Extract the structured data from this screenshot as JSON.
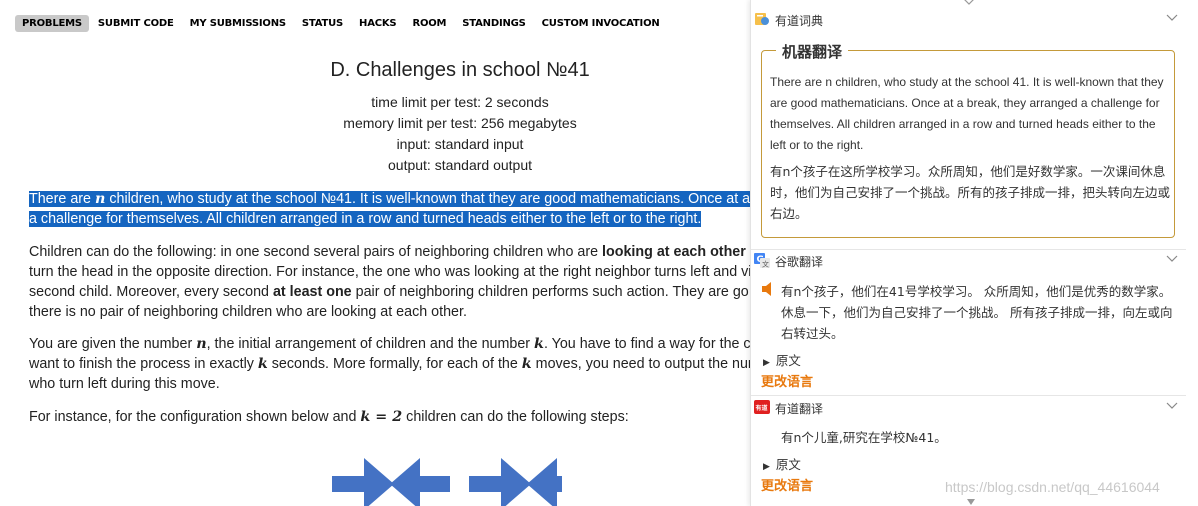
{
  "nav": {
    "items": [
      "PROBLEMS",
      "SUBMIT CODE",
      "MY SUBMISSIONS",
      "STATUS",
      "HACKS",
      "ROOM",
      "STANDINGS",
      "CUSTOM INVOCATION"
    ],
    "active": "PROBLEMS"
  },
  "problem": {
    "title": "D. Challenges in school №41",
    "time_limit": "time limit per test: 2 seconds",
    "memory_limit": "memory limit per test: 256 megabytes",
    "input": "input: standard input",
    "output": "output: standard output",
    "p1": {
      "line1_a": "There are ",
      "line1_var": "n",
      "line1_b": " children, who study at the school №41. It is well-known that they are good mathematicians. Once at a b",
      "line2": "a challenge for themselves. All children arranged in a row and turned heads either to the left or to the right."
    },
    "p2": {
      "line1_a": "Children can do the following: in one second several pairs of neighboring children who are ",
      "line1_bold": "looking at each other",
      "line2": "turn the head in the opposite direction. For instance, the one who was looking at the right neighbor turns left and vi",
      "line3_a": "second child. Moreover, every second ",
      "line3_bold": "at least one",
      "line3_b": " pair of neighboring children performs such action. They are go",
      "line4": "there is no pair of neighboring children who are looking at each other."
    },
    "p3": {
      "line1_a": "You are given the number ",
      "line1_var1": "n",
      "line1_b": ", the initial arrangement of children and the number ",
      "line1_var2": "k",
      "line1_c": ". You have to find a way for the ch",
      "line2_a": "want to finish the process in exactly ",
      "line2_var": "k",
      "line2_b": " seconds. More formally, for each of the ",
      "line2_var2": "k",
      "line2_c": " moves, you need to output the num",
      "line3": "who turn left during this move."
    },
    "p4": {
      "a": "For instance, for the configuration shown below and ",
      "var": "k = 2",
      "b": " children can do the following steps:"
    }
  },
  "panel": {
    "youdao_dict": {
      "label": "有道词典",
      "mt_title": "机器翻译",
      "en": "There are n children, who study at the school 41. It is well-known that they are good mathematicians. Once at a break, they arranged a challenge for themselves. All children arranged in a row and turned heads either to the left or to the right.",
      "zh": "有n个孩子在这所学校学习。众所周知，他们是好数学家。一次课间休息时，他们为自己安排了一个挑战。所有的孩子排成一排，把头转向左边或右边。"
    },
    "google": {
      "label": "谷歌翻译",
      "zh": "有n个孩子，他们在41号学校学习。 众所周知，他们是优秀的数学家。 休息一下，他们为自己安排了一个挑战。 所有孩子排成一排，向左或向右转过头。",
      "original": "原文",
      "change_lang": "更改语言"
    },
    "youdao_trans": {
      "label": "有道翻译",
      "zh": "有n个儿童,研究在学校№41。",
      "original": "原文",
      "change_lang": "更改语言"
    }
  },
  "watermark": "https://blog.csdn.net/qq_44616044",
  "colors": {
    "selection": "#1565c0",
    "accent_orange": "#e8790e",
    "mt_border": "#c49a3a",
    "arrow_blue": "#4472c4"
  }
}
